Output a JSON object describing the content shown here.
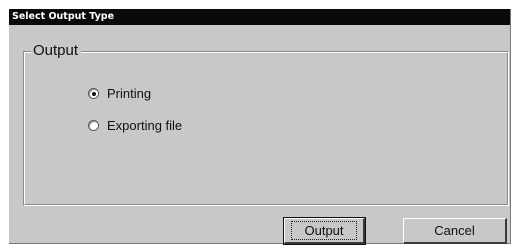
{
  "window": {
    "title": "Select Output Type"
  },
  "group": {
    "label": "Output",
    "options": [
      {
        "label": "Printing",
        "selected": true
      },
      {
        "label": "Exporting file",
        "selected": false
      }
    ]
  },
  "buttons": {
    "output_label": "Output",
    "cancel_label": "Cancel"
  }
}
